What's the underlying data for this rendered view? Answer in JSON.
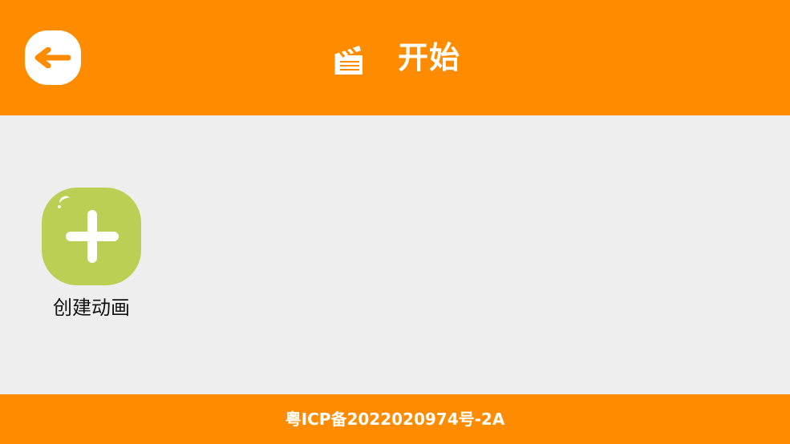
{
  "header": {
    "title": "开始",
    "back_icon": "arrow-left-icon",
    "title_icon": "clapperboard-icon"
  },
  "main": {
    "create_button": {
      "label": "创建动画",
      "icon": "plus-icon"
    }
  },
  "footer": {
    "icp": "粤ICP备2022020974号-2A"
  },
  "colors": {
    "accent": "#ff8c00",
    "background": "#eeeeee",
    "create_tile": "#bccf55"
  }
}
